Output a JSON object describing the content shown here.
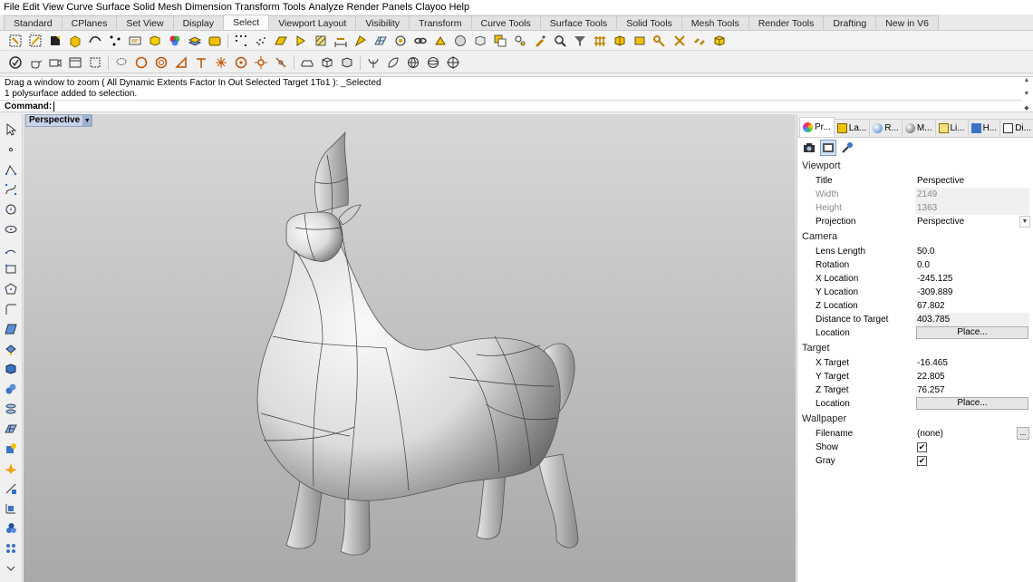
{
  "menu": [
    "File",
    "Edit",
    "View",
    "Curve",
    "Surface",
    "Solid",
    "Mesh",
    "Dimension",
    "Transform",
    "Tools",
    "Analyze",
    "Render",
    "Panels",
    "Clayoo",
    "Help"
  ],
  "tabs": {
    "items": [
      "Standard",
      "CPlanes",
      "Set View",
      "Display",
      "Select",
      "Viewport Layout",
      "Visibility",
      "Transform",
      "Curve Tools",
      "Surface Tools",
      "Solid Tools",
      "Mesh Tools",
      "Render Tools",
      "Drafting",
      "New in V6"
    ],
    "active": "Select"
  },
  "command": {
    "history_line1": "Drag a window to zoom ( All  Dynamic  Extents  Factor  In  Out  Selected  Target  1To1 ): _Selected",
    "history_line2": "1 polysurface added to selection.",
    "prompt_label": "Command:"
  },
  "viewport": {
    "title": "Perspective"
  },
  "panel": {
    "tabs": [
      "Pr...",
      "La...",
      "R...",
      "M...",
      "Li...",
      "H...",
      "Di..."
    ],
    "close": "×",
    "sections": {
      "viewport": {
        "header": "Viewport",
        "title_label": "Title",
        "title_value": "Perspective",
        "width_label": "Width",
        "width_value": "2149",
        "height_label": "Height",
        "height_value": "1363",
        "projection_label": "Projection",
        "projection_value": "Perspective"
      },
      "camera": {
        "header": "Camera",
        "lens_label": "Lens Length",
        "lens_value": "50.0",
        "rotation_label": "Rotation",
        "rotation_value": "0.0",
        "xloc_label": "X Location",
        "xloc_value": "-245.125",
        "yloc_label": "Y Location",
        "yloc_value": "-309.889",
        "zloc_label": "Z Location",
        "zloc_value": "67.802",
        "dist_label": "Distance to Target",
        "dist_value": "403.785",
        "location_label": "Location",
        "place_label": "Place..."
      },
      "target": {
        "header": "Target",
        "xt_label": "X Target",
        "xt_value": "-16.465",
        "yt_label": "Y Target",
        "yt_value": "22.805",
        "zt_label": "Z Target",
        "zt_value": "76.257",
        "location_label": "Location",
        "place_label": "Place..."
      },
      "wallpaper": {
        "header": "Wallpaper",
        "filename_label": "Filename",
        "filename_value": "(none)",
        "browse_label": "...",
        "show_label": "Show",
        "gray_label": "Gray"
      }
    }
  },
  "colors": {
    "viewport_title_bg": "#c6d3e6",
    "model_surface": "#e6e6e6"
  }
}
